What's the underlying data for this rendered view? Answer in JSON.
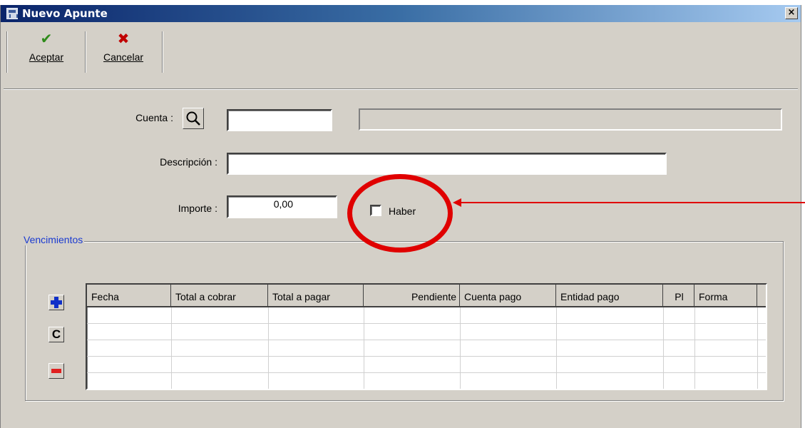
{
  "window": {
    "title": "Nuevo Apunte",
    "close_label": "×"
  },
  "toolbar": {
    "accept": {
      "label": "Aceptar",
      "icon": "check-icon",
      "color": "#2e8b1a"
    },
    "cancel": {
      "label": "Cancelar",
      "icon": "x-icon",
      "color": "#c00000"
    }
  },
  "form": {
    "cuenta_label": "Cuenta :",
    "cuenta_value": "",
    "cuenta_description": "",
    "descripcion_label": "Descripción :",
    "descripcion_value": "",
    "importe_label": "Importe :",
    "importe_value": "0,00",
    "haber_label": "Haber",
    "haber_checked": false
  },
  "vencimientos": {
    "title": "Vencimientos",
    "columns": [
      "Fecha",
      "Total a cobrar",
      "Total a pagar",
      "Pendiente",
      "Cuenta pago",
      "Entidad pago",
      "Pl",
      "Forma"
    ],
    "rows": [],
    "buttons": {
      "add_icon": "plus-icon",
      "clear_label": "C",
      "remove_icon": "minus-icon"
    }
  },
  "annotation": {
    "color": "#e00000",
    "highlight": "haber-checkbox"
  }
}
